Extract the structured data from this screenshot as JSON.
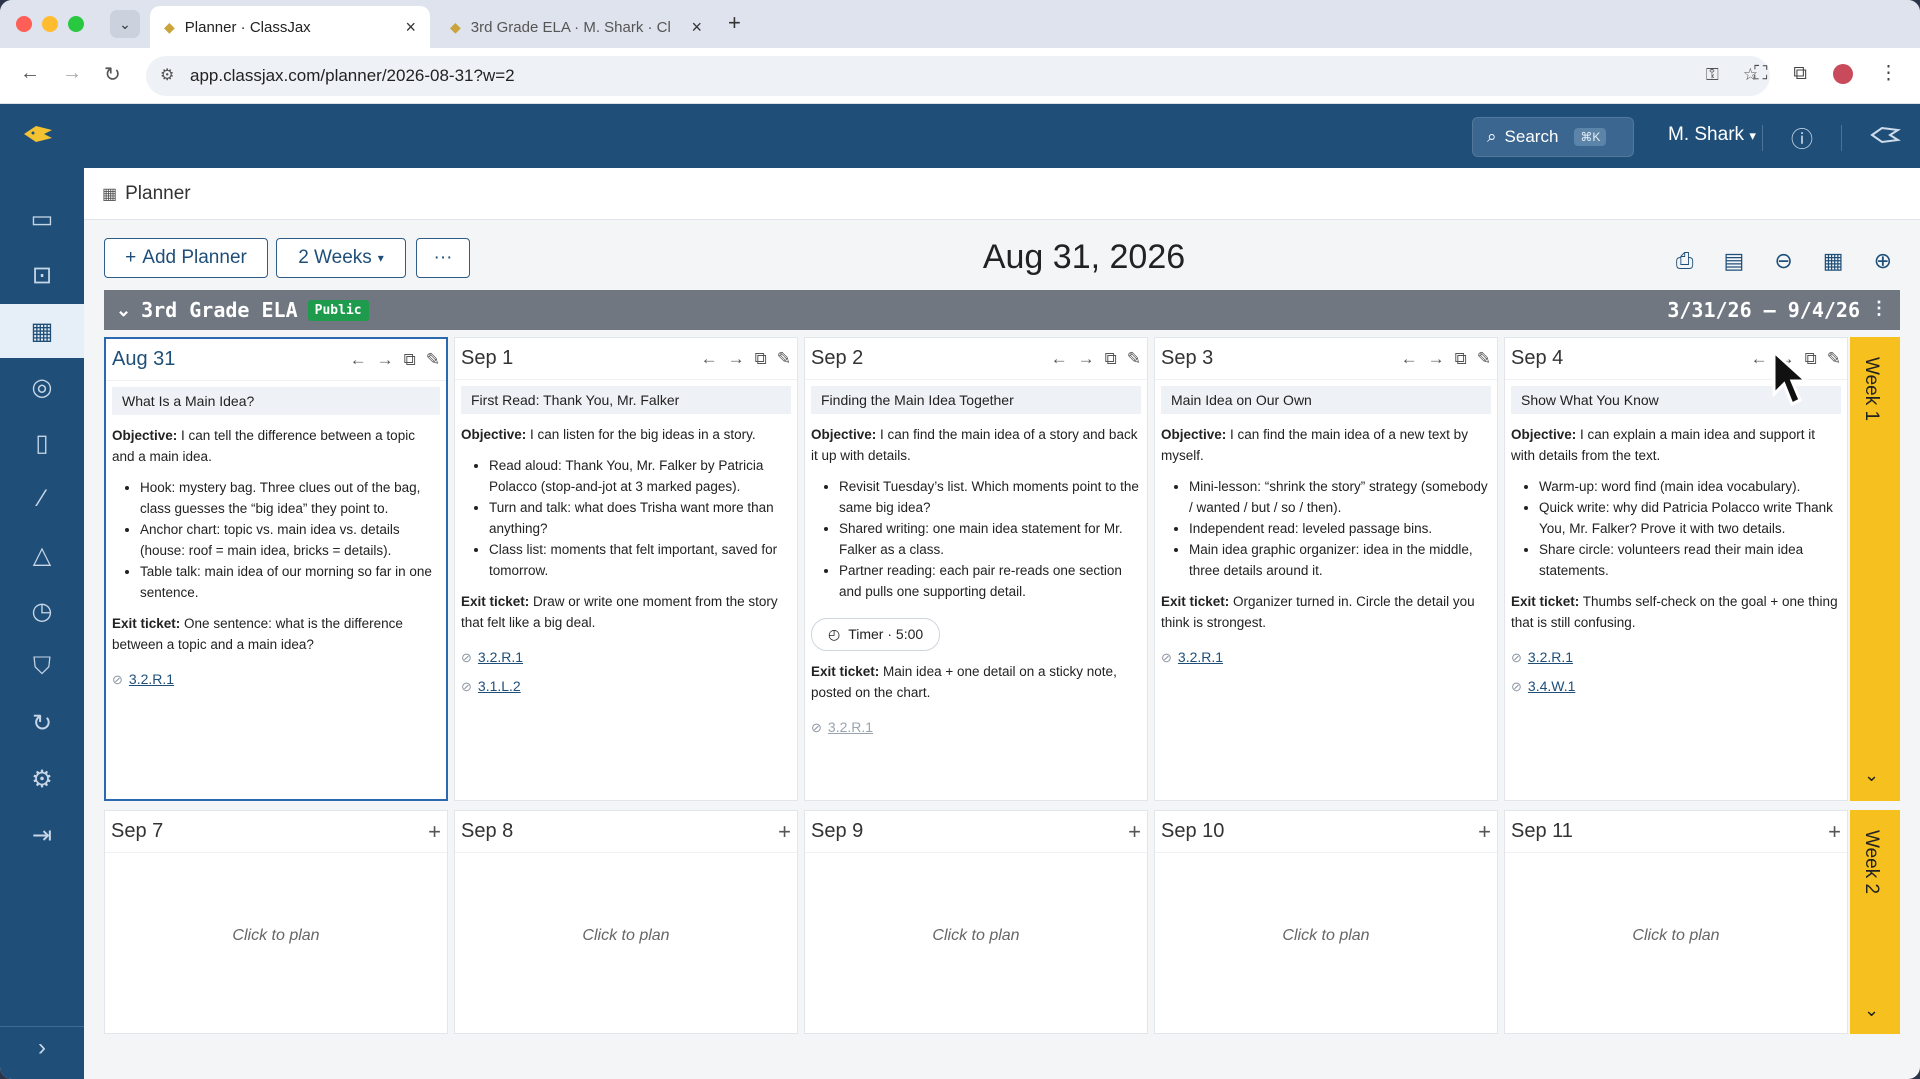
{
  "browser": {
    "tabs": [
      {
        "title": "Planner · ClassJax",
        "active": true
      },
      {
        "title": "3rd Grade ELA · M. Shark · Cl",
        "active": false
      }
    ],
    "url": "app.classjax.com/planner/2026-08-31?w=2"
  },
  "header": {
    "search_label": "Search",
    "search_shortcut": "⌘K",
    "user_name": "M. Shark"
  },
  "breadcrumb": {
    "title": "Planner"
  },
  "toolbar": {
    "add_planner": "Add Planner",
    "range_select": "2 Weeks",
    "more": "···",
    "date_title": "Aug 31, 2026"
  },
  "planner": {
    "name": "3rd Grade ELA",
    "visibility": "Public",
    "date_range": "3/31/26 – 9/4/26"
  },
  "week1": {
    "label": "Week 1",
    "days": [
      {
        "date": "Aug 31",
        "title": "What Is a Main Idea?",
        "objective_label": "Objective:",
        "objective": "I can tell the difference between a topic and a main idea.",
        "bullets": [
          "Hook: mystery bag. Three clues out of the bag, class guesses the “big idea” they point to.",
          "Anchor chart: topic vs. main idea vs. details (house: roof = main idea, bricks = details).",
          "Table talk: main idea of our morning so far in one sentence."
        ],
        "exit_label": "Exit ticket:",
        "exit": "One sentence: what is the difference between a topic and a main idea?",
        "standards": [
          "3.2.R.1"
        ]
      },
      {
        "date": "Sep 1",
        "title": "First Read: Thank You, Mr. Falker",
        "objective_label": "Objective:",
        "objective": "I can listen for the big ideas in a story.",
        "bullets": [
          "Read aloud: Thank You, Mr. Falker by Patricia Polacco (stop-and-jot at 3 marked pages).",
          "Turn and talk: what does Trisha want more than anything?",
          "Class list: moments that felt important, saved for tomorrow."
        ],
        "exit_label": "Exit ticket:",
        "exit": "Draw or write one moment from the story that felt like a big deal.",
        "standards": [
          "3.2.R.1",
          "3.1.L.2"
        ]
      },
      {
        "date": "Sep 2",
        "title": "Finding the Main Idea Together",
        "objective_label": "Objective:",
        "objective": "I can find the main idea of a story and back it up with details.",
        "bullets": [
          "Revisit Tuesday’s list. Which moments point to the same big idea?",
          "Shared writing: one main idea statement for Mr. Falker as a class.",
          "Partner reading: each pair re-reads one section and pulls one supporting detail."
        ],
        "timer": "Timer · 5:00",
        "exit_label": "Exit ticket:",
        "exit": "Main idea + one detail on a sticky note, posted on the chart.",
        "standards": [
          "3.2.R.1"
        ]
      },
      {
        "date": "Sep 3",
        "title": "Main Idea on Our Own",
        "objective_label": "Objective:",
        "objective": "I can find the main idea of a new text by myself.",
        "bullets": [
          "Mini-lesson: “shrink the story” strategy (somebody / wanted / but / so / then).",
          "Independent read: leveled passage bins.",
          "Main idea graphic organizer: idea in the middle, three details around it."
        ],
        "exit_label": "Exit ticket:",
        "exit": "Organizer turned in. Circle the detail you think is strongest.",
        "standards": [
          "3.2.R.1"
        ]
      },
      {
        "date": "Sep 4",
        "title": "Show What You Know",
        "objective_label": "Objective:",
        "objective": "I can explain a main idea and support it with details from the text.",
        "bullets": [
          "Warm-up: word find (main idea vocabulary).",
          "Quick write: why did Patricia Polacco write Thank You, Mr. Falker? Prove it with two details.",
          "Share circle: volunteers read their main idea statements."
        ],
        "exit_label": "Exit ticket:",
        "exit": "Thumbs self-check on the goal + one thing that is still confusing.",
        "standards": [
          "3.2.R.1",
          "3.4.W.1"
        ]
      }
    ]
  },
  "week2": {
    "label": "Week 2",
    "days": [
      {
        "date": "Sep 7",
        "placeholder": "Click to plan"
      },
      {
        "date": "Sep 8",
        "placeholder": "Click to plan"
      },
      {
        "date": "Sep 9",
        "placeholder": "Click to plan"
      },
      {
        "date": "Sep 10",
        "placeholder": "Click to plan"
      },
      {
        "date": "Sep 11",
        "placeholder": "Click to plan"
      }
    ]
  },
  "colors": {
    "brand": "#1f4f79",
    "accent": "#f6c01e",
    "public_badge": "#1f9b4d",
    "selected_border": "#2a69b0"
  }
}
